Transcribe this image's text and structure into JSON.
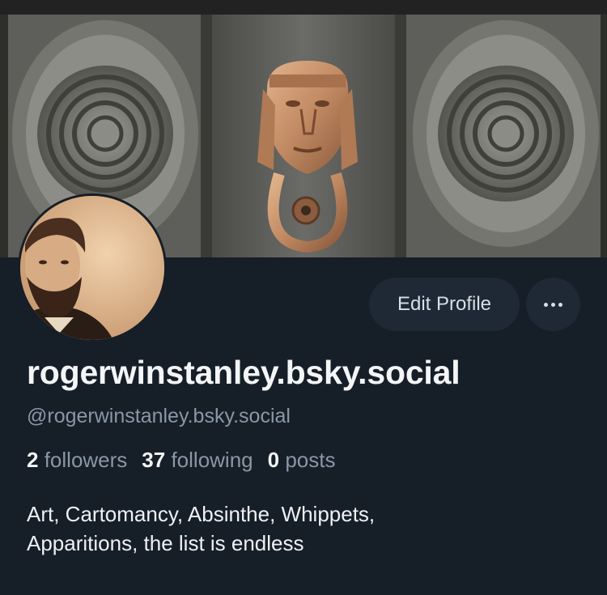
{
  "profile": {
    "display_name": "rogerwinstanley.bsky.social",
    "handle": "@rogerwinstanley.bsky.social",
    "bio_line1": "Art, Cartomancy, Absinthe, Whippets,",
    "bio_line2": "Apparitions, the list is endless"
  },
  "stats": {
    "followers_count": "2",
    "followers_label": "followers",
    "following_count": "37",
    "following_label": "following",
    "posts_count": "0",
    "posts_label": "posts"
  },
  "actions": {
    "edit_profile_label": "Edit Profile",
    "more_icon": "ellipsis-icon"
  },
  "colors": {
    "background": "#161e27",
    "button_bg": "#1e2935",
    "primary_text": "#f3f5f7",
    "secondary_text": "#8a97a6"
  }
}
